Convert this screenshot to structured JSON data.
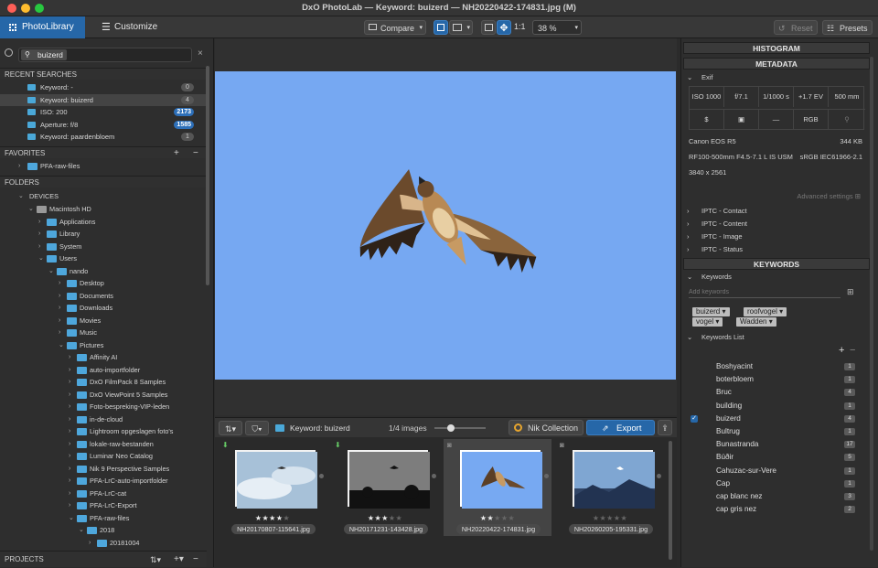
{
  "window": {
    "title": "DxO PhotoLab — Keyword: buizerd — NH20220422-174831.jpg (M)"
  },
  "toolbar": {
    "tab_photolibrary": "PhotoLibrary",
    "tab_customize": "Customize",
    "compare": "Compare",
    "one_to_one": "1:1",
    "zoom": "38 %",
    "reset": "Reset",
    "presets": "Presets"
  },
  "search": {
    "tag": "buizerd"
  },
  "recent_searches": {
    "header": "RECENT SEARCHES",
    "items": [
      {
        "label": "Keyword: -",
        "count": "0",
        "blue": false
      },
      {
        "label": "Keyword: buizerd",
        "count": "4",
        "blue": false
      },
      {
        "label": "ISO: 200",
        "count": "2173",
        "blue": true
      },
      {
        "label": "Aperture: f/8",
        "count": "1585",
        "blue": true
      },
      {
        "label": "Keyword: paardenbloem",
        "count": "1",
        "blue": false
      }
    ]
  },
  "favorites": {
    "header": "FAVORITES",
    "items": [
      "PFA-raw-files"
    ]
  },
  "folders": {
    "header": "FOLDERS",
    "devices": "DEVICES",
    "tree": [
      {
        "label": "Macintosh HD",
        "level": 1,
        "open": true,
        "disk": true
      },
      {
        "label": "Applications",
        "level": 2,
        "open": false
      },
      {
        "label": "Library",
        "level": 2,
        "open": false
      },
      {
        "label": "System",
        "level": 2,
        "open": false
      },
      {
        "label": "Users",
        "level": 2,
        "open": true
      },
      {
        "label": "nando",
        "level": 3,
        "open": true
      },
      {
        "label": "Desktop",
        "level": 4,
        "open": false
      },
      {
        "label": "Documents",
        "level": 4,
        "open": false
      },
      {
        "label": "Downloads",
        "level": 4,
        "open": false
      },
      {
        "label": "Movies",
        "level": 4,
        "open": false
      },
      {
        "label": "Music",
        "level": 4,
        "open": false
      },
      {
        "label": "Pictures",
        "level": 4,
        "open": true
      },
      {
        "label": "Affinity AI",
        "level": 5,
        "open": false
      },
      {
        "label": "auto-importfolder",
        "level": 5,
        "open": false
      },
      {
        "label": "DxO FilmPack 8 Samples",
        "level": 5,
        "open": false
      },
      {
        "label": "DxO ViewPoint 5 Samples",
        "level": 5,
        "open": false
      },
      {
        "label": "Foto-bespreking-VIP-leden",
        "level": 5,
        "open": false
      },
      {
        "label": "in-de-cloud",
        "level": 5,
        "open": false
      },
      {
        "label": "Lightroom opgeslagen foto's",
        "level": 5,
        "open": false
      },
      {
        "label": "lokale-raw-bestanden",
        "level": 5,
        "open": false
      },
      {
        "label": "Luminar Neo Catalog",
        "level": 5,
        "open": false
      },
      {
        "label": "Nik 9 Perspective Samples",
        "level": 5,
        "open": false
      },
      {
        "label": "PFA-LrC-auto-importfolder",
        "level": 5,
        "open": false
      },
      {
        "label": "PFA-LrC-cat",
        "level": 5,
        "open": false
      },
      {
        "label": "PFA-LrC-Export",
        "level": 5,
        "open": false
      },
      {
        "label": "PFA-raw-files",
        "level": 5,
        "open": true
      },
      {
        "label": "2018",
        "level": 6,
        "open": true
      },
      {
        "label": "20181004",
        "level": 7,
        "open": false
      }
    ]
  },
  "projects": {
    "header": "PROJECTS"
  },
  "filmstrip": {
    "location": "Keyword: buizerd",
    "count": "1/4 images",
    "nik": "Nik Collection",
    "export": "Export",
    "thumbs": [
      {
        "name": "NH20170807-115641.jpg",
        "stars": "★★★★★",
        "rating": 4,
        "selected": false
      },
      {
        "name": "NH20171231-143428.jpg",
        "stars": "★★★★★",
        "rating": 3,
        "selected": false
      },
      {
        "name": "NH20220422-174831.jpg",
        "stars": "★★★★★",
        "rating": 2,
        "selected": true
      },
      {
        "name": "NH20260205-195331.jpg",
        "stars": "★★★★★",
        "rating": 0,
        "selected": false
      }
    ]
  },
  "histogram": {
    "header": "HISTOGRAM"
  },
  "metadata": {
    "header": "METADATA",
    "exif_label": "Exif",
    "iso": "ISO 1000",
    "aperture": "f/7.1",
    "shutter": "1/1000 s",
    "ev": "+1.7 EV",
    "focal": "500 mm",
    "color": "RGB",
    "dash": "—",
    "camera": "Canon EOS R5",
    "size": "344 KB",
    "lens": "RF100-500mm F4.5-7.1 L IS USM",
    "profile": "sRGB IEC61966-2.1",
    "dims": "3840 x 2561",
    "advanced": "Advanced settings",
    "iptc": [
      "IPTC - Contact",
      "IPTC - Content",
      "IPTC - Image",
      "IPTC - Status"
    ]
  },
  "keywords": {
    "header": "KEYWORDS",
    "section": "Keywords",
    "placeholder": "Add keywords",
    "chips": [
      "buizerd",
      "roofvogel",
      "vogel",
      "Wadden"
    ],
    "list_label": "Keywords List",
    "list": [
      {
        "name": "Boshyacint",
        "count": "1",
        "checked": false
      },
      {
        "name": "boterbloem",
        "count": "1",
        "checked": false
      },
      {
        "name": "Bruc",
        "count": "4",
        "checked": false
      },
      {
        "name": "building",
        "count": "1",
        "checked": false
      },
      {
        "name": "buizerd",
        "count": "4",
        "checked": true
      },
      {
        "name": "Bultrug",
        "count": "1",
        "checked": false
      },
      {
        "name": "Bunastranda",
        "count": "17",
        "checked": false
      },
      {
        "name": "Búðir",
        "count": "5",
        "checked": false
      },
      {
        "name": "Cahuzac-sur-Vere",
        "count": "1",
        "checked": false
      },
      {
        "name": "Cap",
        "count": "1",
        "checked": false
      },
      {
        "name": "cap blanc nez",
        "count": "3",
        "checked": false
      },
      {
        "name": "cap gris nez",
        "count": "2",
        "checked": false
      }
    ]
  },
  "colors": {
    "accent": "#2667a8",
    "folder": "#4ea7dc",
    "sky": "#76a8f2"
  }
}
